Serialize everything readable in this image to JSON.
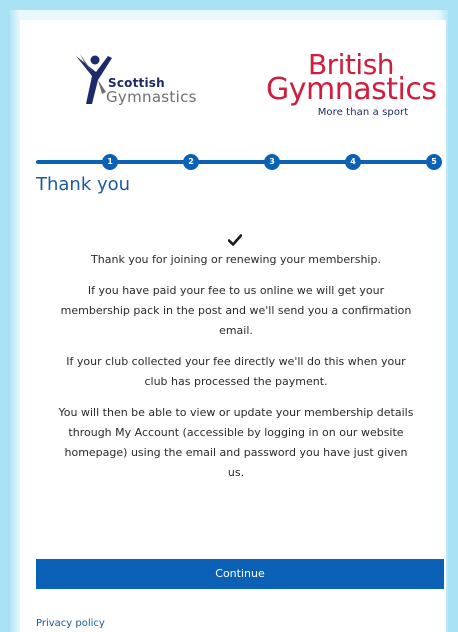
{
  "logos": {
    "scottish_top": "Scottish",
    "scottish_bottom": "Gymnastics",
    "british_line1": "British",
    "british_line2": "Gymnastics",
    "british_tagline": "More than a sport"
  },
  "stepper": {
    "steps": [
      "1",
      "2",
      "3",
      "4",
      "5"
    ],
    "current": 5
  },
  "main": {
    "title": "Thank you",
    "check_icon": "checkmark-icon",
    "paragraphs": [
      "Thank you for joining or renewing your membership.",
      "If you have paid your fee to us online we will get your membership pack in the post and we'll send you a confirmation email.",
      "If your club collected your fee directly we'll do this when your club has processed the payment.",
      "You will then be able to view or update your membership details through My Account (accessible by logging in on our website homepage) using the email and password you have just given us."
    ],
    "continue_label": "Continue"
  },
  "footer": {
    "privacy_label": "Privacy policy"
  },
  "colors": {
    "primary": "#0b61b5",
    "brand_red": "#cf1f3d",
    "navy": "#1c2a6b",
    "background": "#a8e0f4"
  }
}
